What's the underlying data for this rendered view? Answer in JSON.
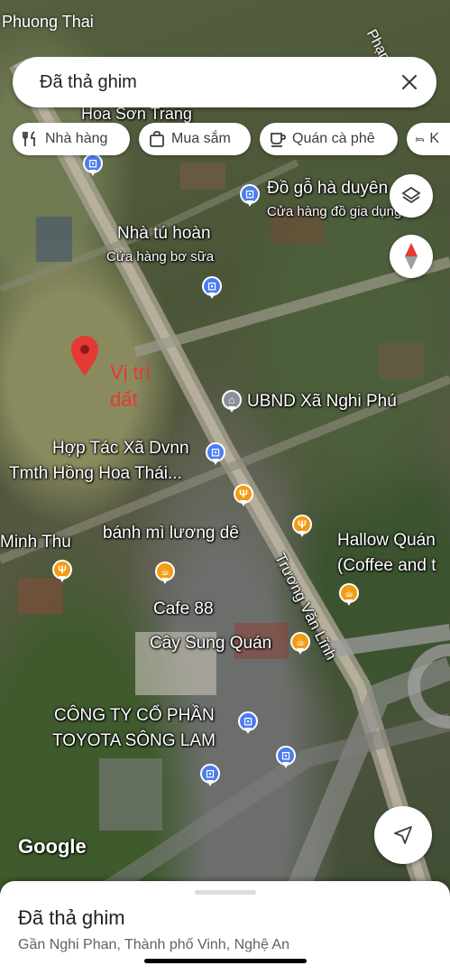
{
  "status_bar": {
    "top_label": "Phuong Thai",
    "road_label": "Phạm T"
  },
  "search": {
    "title": "Đã thả ghim"
  },
  "chips": [
    {
      "label": "Nhà hàng",
      "icon": "fork-knife-icon"
    },
    {
      "label": "Mua sắm",
      "icon": "shopping-bag-icon"
    },
    {
      "label": "Quán cà phê",
      "icon": "coffee-cup-icon"
    },
    {
      "label": "K",
      "icon": "bed-icon"
    }
  ],
  "map_labels": {
    "hoa_son_trang": "Hoa Sơn Trang",
    "do_go": "Đồ gỗ hà duyên",
    "do_go_sub": "Cửa hàng đồ gia dụng",
    "nha_tu_hoan": "Nhà tú hoàn",
    "nha_tu_hoan_sub": "Cửa hàng bơ sữa",
    "vi_tri_dat": "Vị trí\ndất",
    "ubnd": "UBND Xã Nghi Phú",
    "htx_line1": "Hợp Tác Xã Dvnn",
    "htx_line2": "Tmth Hồng Hoa Thái...",
    "minh_thu": "Minh Thu",
    "banh_mi": "bánh mì lương dê",
    "hallow_line1": "Hallow Quán",
    "hallow_line2": "(Coffee and t",
    "truong_van_linh": "Trương Văn Lĩnh",
    "cafe88": "Cafe 88",
    "cay_sung": "Cây Sung Quán",
    "toyota_line1": "CÔNG TY CỔ PHẦN",
    "toyota_line2": "TOYOTA SÔNG LAM",
    "google": "Google"
  },
  "pin_color": "#e53935",
  "accent_blue": "#4b7cf0",
  "accent_orange": "#f39c12",
  "bottom_sheet": {
    "title": "Đã thả ghim",
    "subtitle": "Gần Nghi Phan, Thành phố Vinh, Nghệ An"
  },
  "buttons": {
    "layers": "layers-icon",
    "compass": "compass-icon",
    "location": "navigation-arrow-icon",
    "close": "close-icon"
  }
}
